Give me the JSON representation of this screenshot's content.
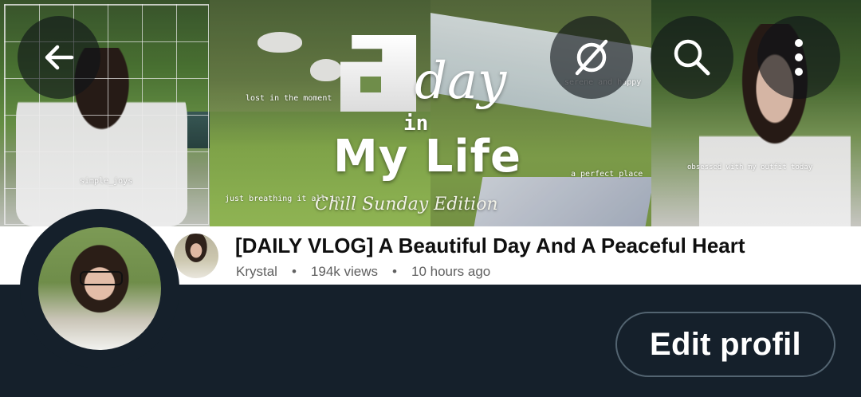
{
  "banner": {
    "title_art": {
      "letter_a": "a",
      "day": "day",
      "in": "in",
      "my_life": "My Life",
      "edition": "Chill Sunday Edition"
    },
    "captions": [
      "lost in the moment",
      "serene and happy",
      "simple_joys",
      "just breathing it all in",
      "a perfect place",
      "obsessed with my outfit today"
    ]
  },
  "top_bar": {
    "back_icon": "arrow-left",
    "grok_icon": "slashed-circle",
    "search_icon": "magnifier",
    "more_icon": "vertical-dots"
  },
  "video": {
    "title": "[DAILY VLOG] A Beautiful Day And A Peaceful Heart",
    "channel": "Krystal",
    "views": "194k views",
    "time": "10 hours ago",
    "separator": "•"
  },
  "profile": {
    "edit_label": "Edit profil"
  },
  "colors": {
    "background": "#15202b",
    "button_border": "#536471",
    "info_strip": "#ffffff"
  }
}
